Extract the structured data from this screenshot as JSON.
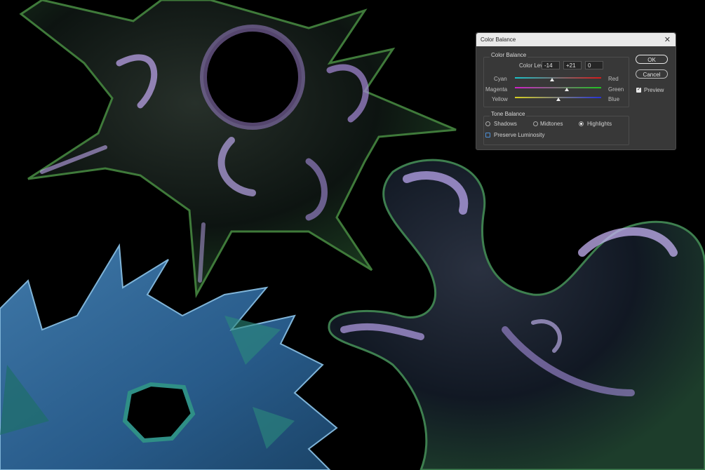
{
  "dialog": {
    "title": "Color Balance",
    "color_balance_group": "Color Balance",
    "color_levels_label": "Color Levels:",
    "levels": [
      "-14",
      "+21",
      "0"
    ],
    "sliders": [
      {
        "left": "Cyan",
        "right": "Red",
        "value": -14,
        "left_color": "#19c3c9",
        "right_color": "#d61a1a"
      },
      {
        "left": "Magenta",
        "right": "Green",
        "value": 21,
        "left_color": "#d020c9",
        "right_color": "#1fc520"
      },
      {
        "left": "Yellow",
        "right": "Blue",
        "value": 0,
        "left_color": "#d8d020",
        "right_color": "#2633d8"
      }
    ],
    "slider_range": [
      -100,
      100
    ],
    "tone_balance_group": "Tone Balance",
    "tones": [
      {
        "label": "Shadows",
        "selected": false
      },
      {
        "label": "Midtones",
        "selected": false
      },
      {
        "label": "Highlights",
        "selected": true
      }
    ],
    "preserve_luminosity": {
      "label": "Preserve Luminosity",
      "checked": false
    },
    "ok_label": "OK",
    "cancel_label": "Cancel",
    "preview": {
      "label": "Preview",
      "checked": true
    },
    "close_icon": "close-icon"
  }
}
